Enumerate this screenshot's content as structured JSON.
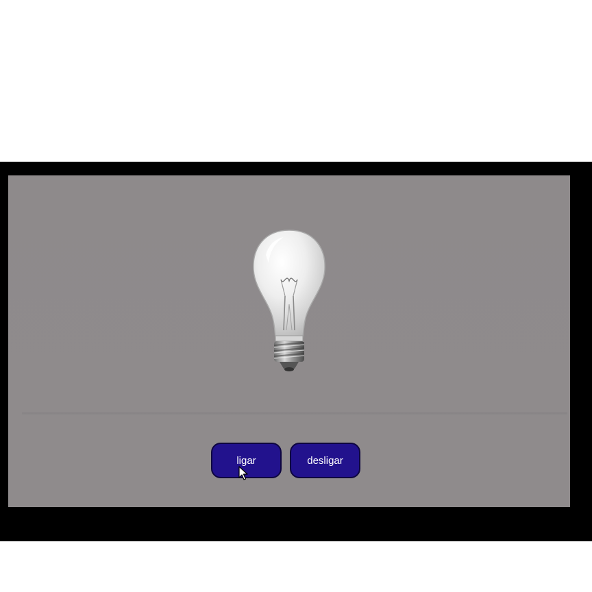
{
  "controls": {
    "on_label": "ligar",
    "off_label": "desligar"
  },
  "bulb": {
    "icon": "lightbulb-icon",
    "state": "off"
  },
  "colors": {
    "frame": "#000000",
    "stage": "#8f8b8c",
    "button_bg": "#22128d",
    "button_text": "#ffffff"
  }
}
